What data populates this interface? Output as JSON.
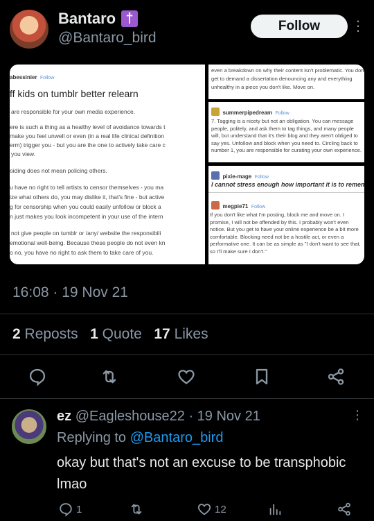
{
  "header": {
    "display_name": "Bantaro",
    "badge_glyph": "†",
    "handle": "@Bantaro_bird",
    "follow_label": "Follow",
    "more_glyph": "⋮"
  },
  "media": {
    "left": {
      "user": "abessinier",
      "follow": "Follow",
      "title": "ff kids on tumblr better relearn",
      "lines": [
        "are responsible for your own media experience.",
        "ere is such a thing as a healthy level of avoidance towards t",
        "make you feel unwell or even (in a real life clinical definition",
        "erm) trigger you - but you are the one to actively take care c",
        "you view.",
        "oiding does not mean policing others.",
        "u have no right to tell artists to censor themselves - you ma",
        "ize what others do, you may dislike it, that's fine - but active",
        "g for censorship when you could easily unfollow or block a",
        "n just makes you look incompetent in your use of the intern",
        "not give people on tumblr or /any/ website the responsibili",
        "emotional well-being. Because these people do not even kn",
        "o no, you have no right to ask them to take care of you."
      ]
    },
    "right_top": {
      "lines": [
        "even a breakdown on why their content isn't problematic. You don't",
        "get to demand a dissertation denouncing any and everything",
        "unhealthy in a piece you don't like. Move on."
      ]
    },
    "right_mid": {
      "user": "summerpipedream",
      "follow": "Follow",
      "text": "7. Tagging is a nicety but not an obligation. You can message people, politely, and ask them to tag things, and many people will, but understand that it's their blog and they aren't obliged to say yes. Unfollow and block when you need to. Circling back to number 1, you are responsible for curating your own experience."
    },
    "right_bottom": {
      "user1": "pixie-mage",
      "follow1": "Follow",
      "quote": "I cannot stress enough how important it is to remember this.",
      "user2": "megpie71",
      "follow2": "Follow",
      "text": "If you don't like what I'm posting, block me and move on.  I promise, I will not be offended by this.  I probably won't even notice.  But you get to have your online experience be a bit more comfortable. Blocking need not be a hostile act, or even a performative one.  It can be as simple as \"I don't want to see that, so I'll make sure I don't.\""
    }
  },
  "post": {
    "timestamp": "16:08 · 19 Nov 21",
    "reposts_count": "2",
    "reposts_label": "Reposts",
    "quote_count": "1",
    "quote_label": "Quote",
    "likes_count": "17",
    "likes_label": "Likes"
  },
  "actions": {
    "reply_icon": "comment-icon",
    "repost_icon": "repost-icon",
    "like_icon": "heart-icon",
    "bookmark_icon": "bookmark-icon",
    "share_icon": "share-icon"
  },
  "reply": {
    "name": "ez",
    "handle": "@Eagleshouse22",
    "date": "· 19 Nov 21",
    "replying_prefix": "Replying to",
    "replying_to": "@Bantaro_bird",
    "text": "okay but that's not an excuse to be transphobic lmao",
    "reply_count": "1",
    "like_count": "12",
    "more_glyph": "⋮"
  },
  "colors": {
    "background": "#000000",
    "text_primary": "#e7e9ea",
    "text_secondary": "#8b98a5",
    "link": "#1d9bf0",
    "divider": "#2f3336",
    "badge": "#9b59d0"
  }
}
